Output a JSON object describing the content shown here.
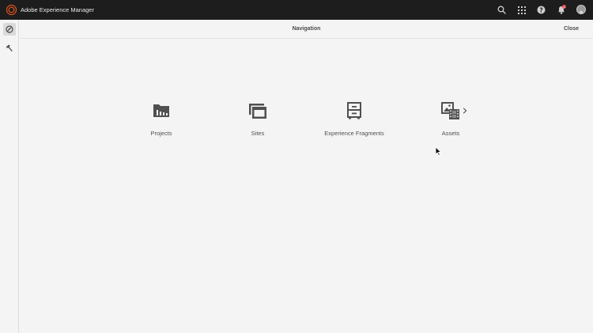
{
  "app": {
    "title": "Adobe Experience Manager"
  },
  "header": {
    "title": "Navigation",
    "close_label": "Close"
  },
  "topbar": {
    "icons": [
      "search-icon",
      "apps-grid-icon",
      "help-icon",
      "bell-icon",
      "avatar"
    ],
    "notification_count": "1"
  },
  "rail": {
    "items": [
      "navigation-icon",
      "tools-hammer-icon"
    ]
  },
  "navigation": {
    "items": [
      {
        "label": "Projects",
        "icon": "projects-folder-icon"
      },
      {
        "label": "Sites",
        "icon": "sites-icon"
      },
      {
        "label": "Experience Fragments",
        "icon": "experience-fragments-icon"
      },
      {
        "label": "Assets",
        "icon": "assets-icon",
        "has_children": true
      }
    ]
  },
  "colors": {
    "topbar": "#1d1d1d",
    "background": "#f4f4f4",
    "logo": "#e8541f",
    "badge": "#e34850"
  }
}
